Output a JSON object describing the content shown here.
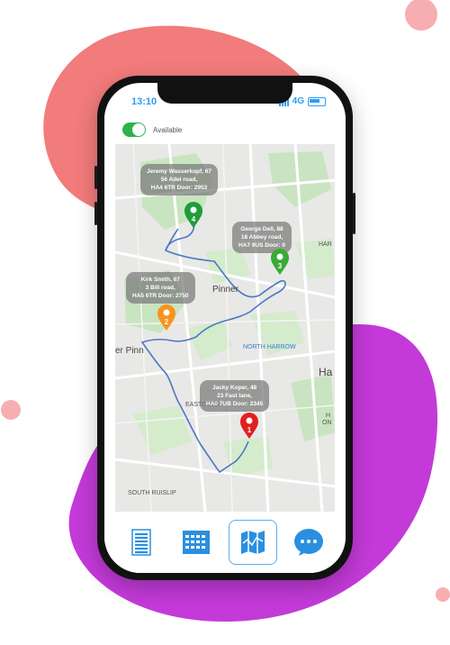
{
  "status_bar": {
    "time": "13:10",
    "network": "4G"
  },
  "availability": {
    "label": "Available",
    "enabled": true
  },
  "map": {
    "places": {
      "pinner": "Pinner",
      "north_harrow": "NORTH HARROW",
      "eastcote": "EASTCOTE",
      "south_ruislip": "SOUTH RUISLIP",
      "pinn_partial": "er Pinn",
      "harrow_partial": "Ha",
      "har_partial": "HAR",
      "on_partial": "ON",
      "h_partial": "H"
    },
    "stops": [
      {
        "number": "1",
        "color": "#e02020",
        "lines": [
          "Jacky Koper, 48",
          "23 Fast lane,",
          "HA0 7UB Door: 2345"
        ]
      },
      {
        "number": "2",
        "color": "#f7941d",
        "lines": [
          "Kirk Smith, 67",
          "3 Bill road,",
          "HA5 6TR Door: 2750"
        ]
      },
      {
        "number": "3",
        "color": "#3aaa35",
        "lines": [
          "George Dell, 88",
          "18 Abbey road,",
          "HA7 9US Door: 0"
        ]
      },
      {
        "number": "4",
        "color": "#1f9d3a",
        "lines": [
          "Jeremy Wasserkopf, 67",
          "56 Adel road,",
          "HA4 6TR Door: 2953"
        ]
      }
    ],
    "route_color": "#4c78c4"
  },
  "tabs": [
    {
      "icon": "list-icon",
      "active": false
    },
    {
      "icon": "calendar-icon",
      "active": false
    },
    {
      "icon": "map-icon",
      "active": true
    },
    {
      "icon": "chat-icon",
      "active": false
    }
  ],
  "colors": {
    "accent": "#2a9df4",
    "blob_pink": "#f27b7b",
    "blob_purple": "#c33ad9"
  }
}
